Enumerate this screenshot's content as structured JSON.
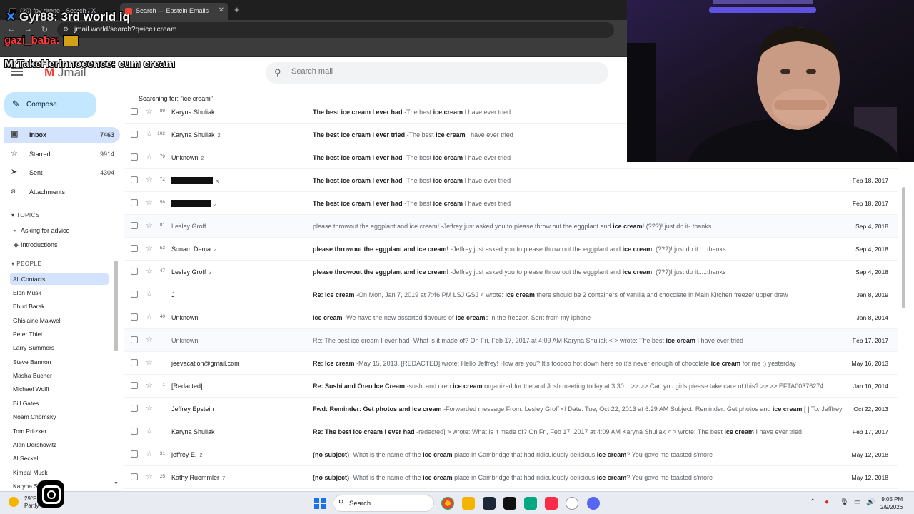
{
  "browser": {
    "tabs": [
      {
        "title": "(20) fpv drone - Search / X",
        "active": false
      },
      {
        "title": "Search — Epstein Emails",
        "active": true
      }
    ],
    "new_tab": "+",
    "url": "jmail.world/search?q=ice+cream"
  },
  "stream_chat": [
    {
      "user": "Gyr88:",
      "message": "3rd world iq"
    },
    {
      "user": "gazi_baba:",
      "message": ""
    },
    {
      "user": "MrTakeHerInnocence:",
      "message": "cum cream"
    }
  ],
  "app": {
    "logo": "Jmail",
    "search_placeholder": "Search mail",
    "compose_label": "Compose",
    "searching_for": "Searching for: \"ice cream\""
  },
  "nav": [
    {
      "label": "Inbox",
      "count": "7463",
      "icon": "inbox-icon",
      "active": true
    },
    {
      "label": "Starred",
      "count": "9914",
      "icon": "star-icon",
      "active": false
    },
    {
      "label": "Sent",
      "count": "4304",
      "icon": "send-icon",
      "active": false
    },
    {
      "label": "Attachments",
      "count": "",
      "icon": "paperclip-icon",
      "active": false
    }
  ],
  "topics": {
    "header": "TOPICS",
    "items": [
      "Asking for advice",
      "Introductions"
    ]
  },
  "people": {
    "header": "PEOPLE",
    "items": [
      "All Contacts",
      "Elon Musk",
      "Ehud Barak",
      "Ghislaine Maxwell",
      "Peter Thiel",
      "Larry Summers",
      "Steve Bannon",
      "Masha Bucher",
      "Michael Wolff",
      "Bill Gates",
      "Noam Chomsky",
      "Tom Pritzker",
      "Alan Dershowitz",
      "Al Seckel",
      "Kimbal Musk",
      "Karyna S"
    ]
  },
  "emails": [
    {
      "num": "89",
      "sender": "Karyna Shuliak",
      "sender_count": "",
      "redacted": false,
      "subject": "The best ice cream I ever had",
      "snippet": "-The best ice cream I have ever tried",
      "date": "",
      "read": false
    },
    {
      "num": "102",
      "sender": "Karyna Shuliak",
      "sender_count": "2",
      "redacted": false,
      "subject": "The best ice cream I ever tried",
      "snippet": "-The best ice cream I have ever tried",
      "date": "",
      "read": false
    },
    {
      "num": "79",
      "sender": "Unknown",
      "sender_count": "2",
      "redacted": false,
      "subject": "The best ice cream I ever had",
      "snippet": "-The best ice cream I have ever tried",
      "date": "",
      "read": false
    },
    {
      "num": "72",
      "sender": "",
      "sender_count": "3",
      "redacted": true,
      "subject": "The best ice cream I ever had",
      "snippet": "-The best ice cream I have ever tried",
      "date": "Feb 18, 2017",
      "read": false
    },
    {
      "num": "58",
      "sender": "",
      "sender_count": "2",
      "redacted": true,
      "subject": "The best ice cream I ever had",
      "snippet": "-The best ice cream I have ever tried",
      "date": "Feb 18, 2017",
      "read": false
    },
    {
      "num": "81",
      "sender": "Lesley Groff",
      "sender_count": "",
      "redacted": false,
      "subject": "please throwout the eggplant and ice cream!",
      "snippet": "-Jeffrey just asked you to please throw out the eggplant and ice cream! (???)! just do it-.thanks",
      "date": "Sep 4, 2018",
      "read": true
    },
    {
      "num": "53",
      "sender": "Sonam Dema",
      "sender_count": "2",
      "redacted": false,
      "subject": "please throwout the eggplant and ice cream!",
      "snippet": "-Jeffrey just asked you to please throw out the eggplant and ice cream! (???)! just do it.....thanks",
      "date": "Sep 4, 2018",
      "read": false
    },
    {
      "num": "47",
      "sender": "Lesley Groff",
      "sender_count": "3",
      "redacted": false,
      "subject": "please throwout the eggplant and ice cream!",
      "snippet": "-Jeffrey just asked you to please throw out the eggplant and ice cream! (???)! just do it.....thanks",
      "date": "Sep 4, 2018",
      "read": false
    },
    {
      "num": "",
      "sender": "J",
      "sender_count": "",
      "redacted": false,
      "subject": "Re: Ice cream",
      "snippet": "-On Mon, Jan 7, 2019 at 7:46 PM LSJ GSJ < wrote: Ice cream there should be 2 containers of vanilla and chocolate in Main Kitchen freezer upper draw",
      "date": "Jan 8, 2019",
      "read": false
    },
    {
      "num": "40",
      "sender": "Unknown",
      "sender_count": "",
      "redacted": false,
      "subject": "Ice cream",
      "snippet": "-We have the new assorted flavours of ice creams in the freezer. Sent from my Iphone",
      "date": "Jan 8, 2014",
      "read": false
    },
    {
      "num": "",
      "sender": "Unknown",
      "sender_count": "",
      "redacted": false,
      "subject": "Re: The best ice cream I ever had",
      "snippet": "-What is it made of? On Fri, Feb 17, 2017 at 4:09 AM Karyna Shuliak < > wrote: The best ice cream I have ever tried",
      "date": "Feb 17, 2017",
      "read": true
    },
    {
      "num": "",
      "sender": "jeevacation@gmail.com",
      "sender_count": "",
      "redacted": false,
      "subject": "Re: Ice cream",
      "snippet": "-May 15, 2013, [REDACTED] wrote: Hello Jeffrey! How are you? It's tooooo hot down here so it's never enough of chocolate ice cream for me ;) yesterday",
      "date": "May 16, 2013",
      "read": false
    },
    {
      "num": "1",
      "sender": "[Redacted]",
      "sender_count": "",
      "redacted": false,
      "subject": "Re: Sushi and Oreo Ice Cream",
      "snippet": "-sushi and oreo ice cream organized for the and Josh meeting today at 3:30... >> >> Can you girls please take care of this? >> >> EFTA00376274",
      "date": "Jan 10, 2014",
      "read": false
    },
    {
      "num": "",
      "sender": "Jeffrey Epstein",
      "sender_count": "",
      "redacted": false,
      "subject": "Fwd: Reminder: Get photos and ice cream",
      "snippet": "-Forwarded message From: Lesley Groff <l Date: Tue, Oct 22, 2013 at 6:29 AM Subject: Reminder: Get photos and ice cream [ ] To: Jefffrey",
      "date": "Oct 22, 2013",
      "read": false
    },
    {
      "num": "",
      "sender": "Karyna Shuliak",
      "sender_count": "",
      "redacted": false,
      "subject": "Re: The best ice cream I ever had",
      "snippet": "-redacted] > wrote: What is it made of? On Fri, Feb 17, 2017 at 4:09 AM Karyna Shuliak < > wrote: The best ice cream I have ever tried",
      "date": "Feb 17, 2017",
      "read": false
    },
    {
      "num": "31",
      "sender": "jeffrey E.",
      "sender_count": "2",
      "redacted": false,
      "subject": "(no subject)",
      "snippet": "-What is the name of the ice cream place in Cambridge that had ridiculously delicious ice cream? You gave me toasted s'more",
      "date": "May 12, 2018",
      "read": false
    },
    {
      "num": "25",
      "sender": "Kathy Ruemmler",
      "sender_count": "7",
      "redacted": false,
      "subject": "(no subject)",
      "snippet": "-What is the name of the ice cream place in Cambridge that had ridiculously delicious ice cream? You gave me toasted s'more",
      "date": "May 12, 2018",
      "read": false
    }
  ],
  "taskbar": {
    "weather_temp": "29°F",
    "weather_desc": "Partly",
    "search_label": "Search",
    "time": "9:05 PM",
    "date": "2/9/2026"
  },
  "colors": {
    "browser_dark": "#1f1f1f",
    "compose_bg": "#c2e7ff",
    "nav_active": "#d3e3fd",
    "logo_red": "#ea4335"
  }
}
